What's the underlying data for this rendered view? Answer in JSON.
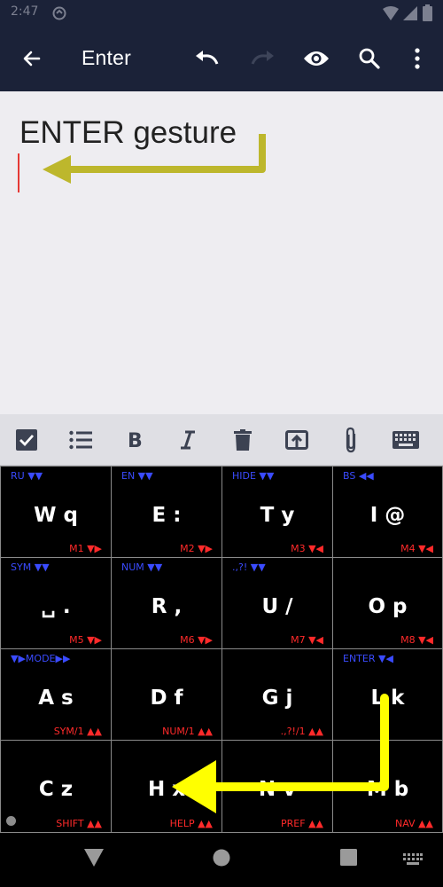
{
  "status_bar": {
    "time": "2:47"
  },
  "toolbar": {
    "title": "Enter",
    "back_icon": "arrow-left-icon",
    "undo_icon": "undo-icon",
    "redo_icon": "redo-icon",
    "preview_icon": "eye-icon",
    "search_icon": "search-icon",
    "menu_icon": "more-vert-icon"
  },
  "editor": {
    "text": "ENTER gesture"
  },
  "format_bar": {
    "icons": [
      "checkbox-icon",
      "bullet-list-icon",
      "bold-icon",
      "italic-icon",
      "delete-icon",
      "share-icon",
      "attach-icon",
      "keyboard-icon"
    ]
  },
  "keyboard": {
    "keys": [
      {
        "main": "W q",
        "tl": "RU ▼▼",
        "br": "M1 ▼▶"
      },
      {
        "main": "E :",
        "tl": "EN ▼▼",
        "br": "M2 ▼▶"
      },
      {
        "main": "T y",
        "tl": "HIDE ▼▼",
        "br": "M3 ▼◀"
      },
      {
        "main": "I @",
        "tl": "BS ◀◀",
        "br": "M4 ▼◀"
      },
      {
        "main": "␣ .",
        "tl": "SYM ▼▼",
        "br": "M5 ▼▶"
      },
      {
        "main": "R ,",
        "tl": "NUM ▼▼",
        "br": "M6 ▼▶"
      },
      {
        "main": "U /",
        "tl": ".,?! ▼▼",
        "br": "M7 ▼◀"
      },
      {
        "main": "O p",
        "tl": "",
        "br": "M8 ▼◀"
      },
      {
        "main": "A s",
        "tl": "▼▶MODE▶▶",
        "br": "SYM/1 ▲▲"
      },
      {
        "main": "D f",
        "tl": "",
        "br": "NUM/1 ▲▲"
      },
      {
        "main": "G j",
        "tl": "",
        "br": ".,?!/1 ▲▲"
      },
      {
        "main": "L k",
        "tl": "ENTER ▼◀",
        "br": ""
      },
      {
        "main": "C z",
        "tl": "",
        "br": "SHIFT ▲▲"
      },
      {
        "main": "H x",
        "tl": "",
        "br": "HELP ▲▲"
      },
      {
        "main": "N v",
        "tl": "",
        "br": "PREF ▲▲"
      },
      {
        "main": "M b",
        "tl": "",
        "br": "NAV ▲▲"
      }
    ]
  },
  "nav_bar": {
    "icons": [
      "back-triangle-icon",
      "home-circle-icon",
      "recents-square-icon",
      "keyboard-switch-icon"
    ]
  },
  "colors": {
    "toolbar_bg": "#1b2238",
    "editor_bg": "#eeedf1",
    "annotation_arrow": "#ffff00",
    "annotation_arrow_dim": "#bdb72c",
    "top_label": "#3a4bff",
    "bottom_label": "#ff2a2a"
  }
}
